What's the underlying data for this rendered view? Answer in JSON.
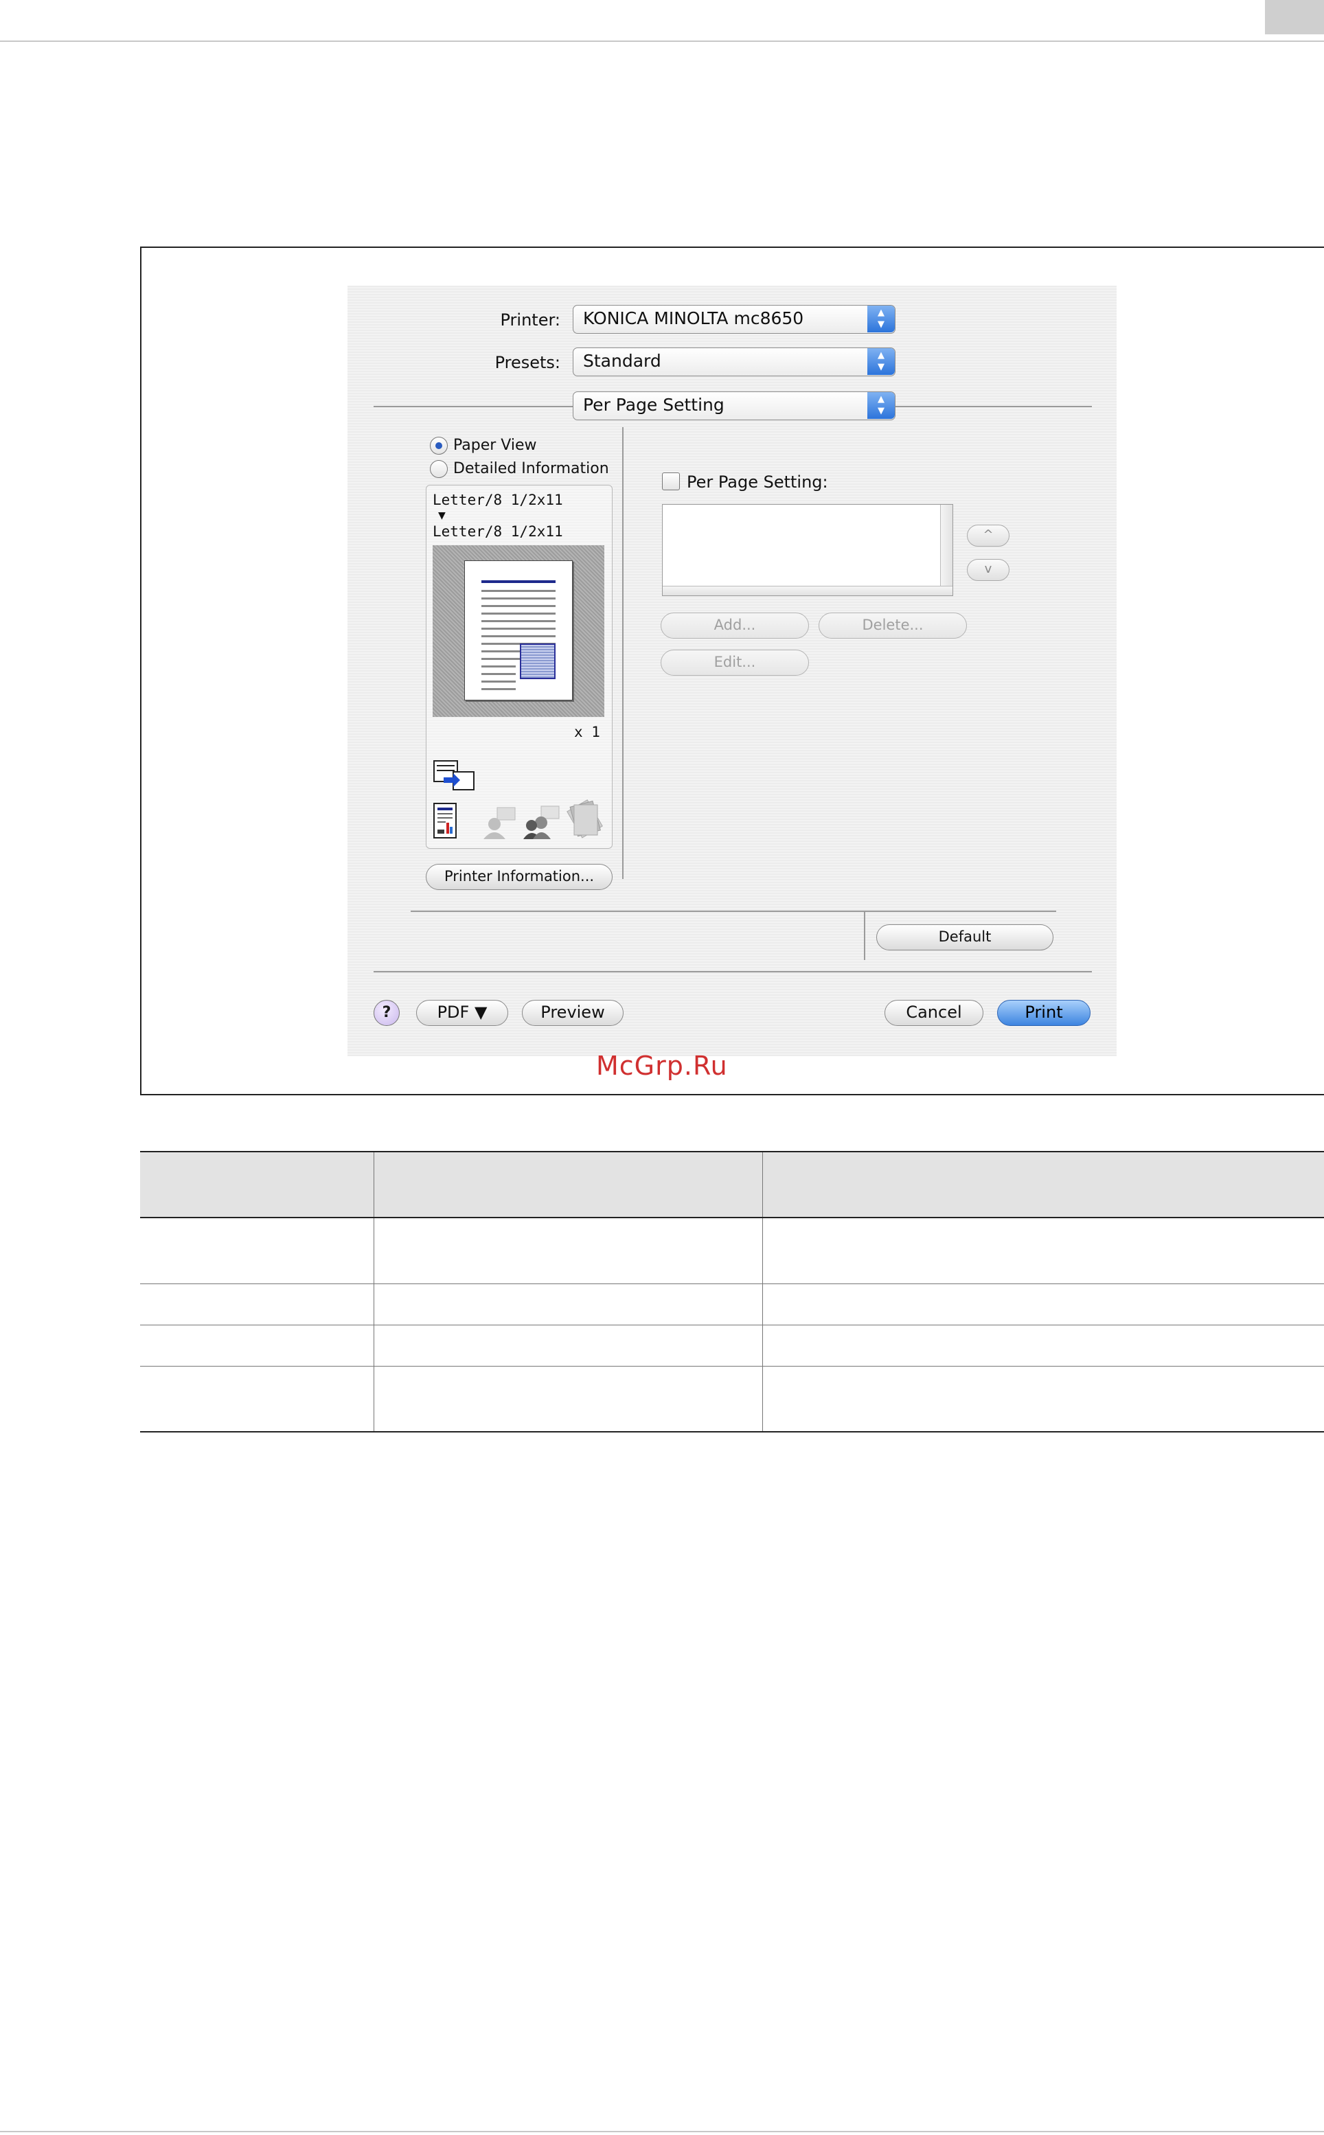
{
  "dialog": {
    "printer_label": "Printer:",
    "printer_value": "KONICA MINOLTA mc8650",
    "presets_label": "Presets:",
    "presets_value": "Standard",
    "pane_value": "Per Page Setting",
    "view_options": [
      {
        "label": "Paper View",
        "selected": true
      },
      {
        "label": "Detailed Information",
        "selected": false
      }
    ],
    "preview": {
      "paper_line_1": "Letter/8 1/2x11",
      "arrow": "▼",
      "paper_line_2": "Letter/8 1/2x11",
      "copies": "x 1"
    },
    "printer_info_button": "Printer Information...",
    "per_page_setting_label": "Per Page Setting:",
    "per_page_setting_checked": false,
    "move_up_glyph": "^",
    "move_down_glyph": "v",
    "add_button": "Add...",
    "delete_button": "Delete...",
    "edit_button": "Edit...",
    "default_button": "Default",
    "help_glyph": "?",
    "pdf_button": "PDF ▼",
    "preview_button": "Preview",
    "cancel_button": "Cancel",
    "print_button": "Print"
  },
  "watermark": "McGrp.Ru",
  "colors": {
    "accent_blue": "#3d84e0",
    "watermark_red": "#d03030",
    "table_header_bg": "#e3e3e3"
  }
}
